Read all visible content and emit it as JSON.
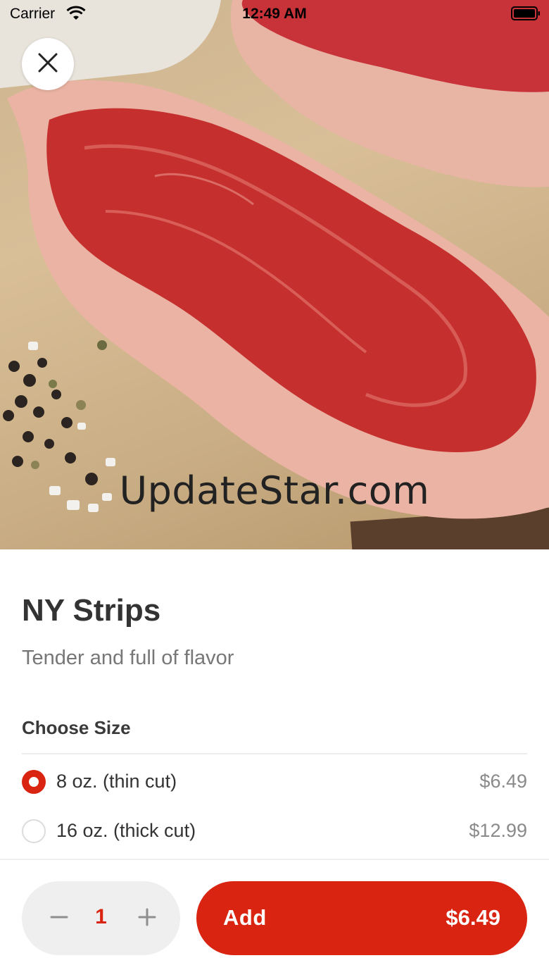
{
  "status_bar": {
    "carrier": "Carrier",
    "time": "12:49 AM"
  },
  "hero": {
    "watermark": "UpdateStar.com"
  },
  "item": {
    "name": "NY Strips",
    "description": "Tender and full of flavor"
  },
  "size_section": {
    "heading": "Choose Size",
    "options": [
      {
        "label": "8 oz. (thin cut)",
        "price": "$6.49",
        "selected": true
      },
      {
        "label": "16 oz. (thick cut)",
        "price": "$12.99",
        "selected": false
      }
    ]
  },
  "footer": {
    "quantity": "1",
    "add_label": "Add",
    "add_price": "$6.49"
  },
  "colors": {
    "accent": "#d92412",
    "stepper_bg": "#efefef",
    "text_primary": "#333333",
    "text_secondary": "#777777"
  },
  "icons": {
    "close": "close-icon",
    "minus": "minus-icon",
    "plus": "plus-icon",
    "wifi": "wifi-icon",
    "battery": "battery-icon"
  }
}
